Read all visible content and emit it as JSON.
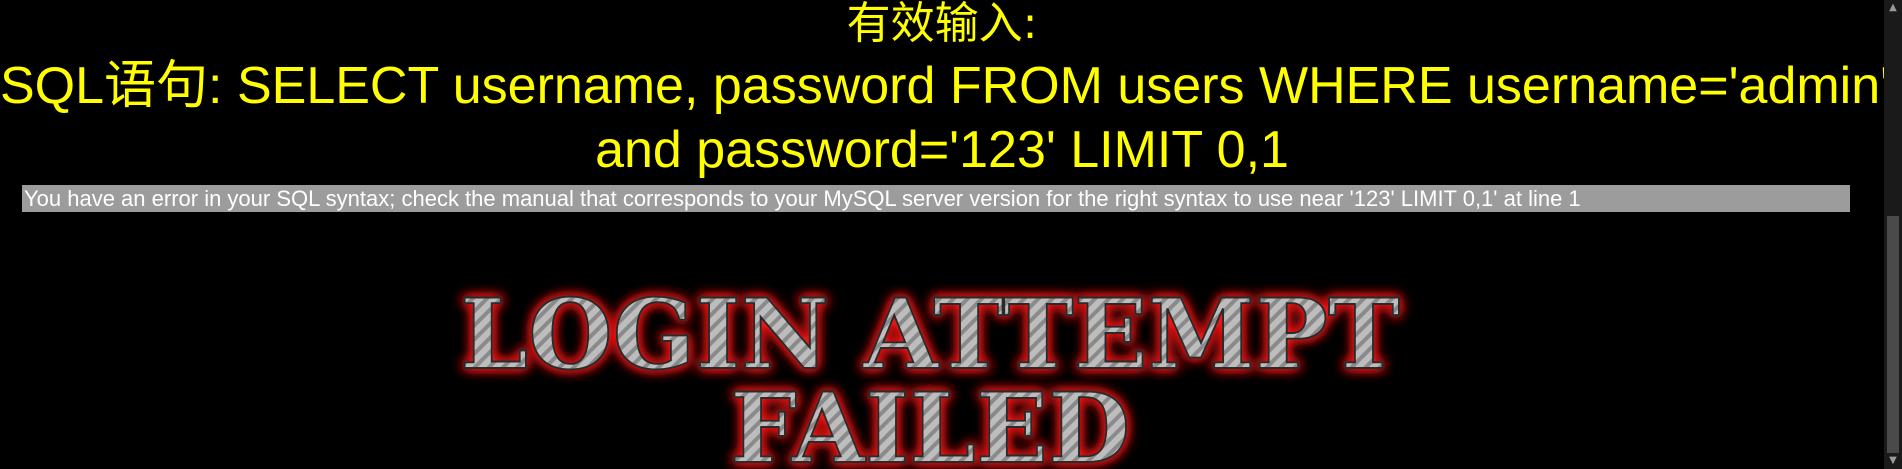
{
  "result": {
    "valid_input_label": "有效输入:",
    "sql_line_1": "SQL语句: SELECT username, password FROM users WHERE username='admin''",
    "sql_line_2": "and password='123' LIMIT 0,1",
    "error_message": "You have an error in your SQL syntax; check the manual that corresponds to your MySQL server version for the right syntax to use near '123' LIMIT 0,1' at line 1"
  },
  "banner": {
    "line_1": "LOGIN ATTEMPT",
    "line_2": "FAILED",
    "style": "metallic text with red glow"
  },
  "colors": {
    "background": "#000000",
    "sql_text": "#ffff00",
    "error_background": "#9c9c9c",
    "error_text": "#ffffff",
    "banner_glow": "#ff1a1a"
  },
  "scrollbar": {
    "up_icon": "chevron-up-icon",
    "down_icon": "chevron-down-icon"
  }
}
